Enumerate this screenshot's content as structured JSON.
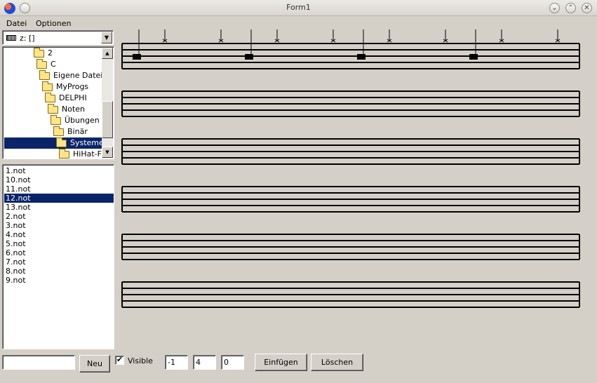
{
  "window": {
    "title": "Form1",
    "minimize": "⌄",
    "maximize": "⌃",
    "close": "✕"
  },
  "menu": [
    "Datei",
    "Optionen"
  ],
  "drive": {
    "value": "z: []",
    "icon": "drive-icon"
  },
  "tree": {
    "items": [
      {
        "label": "2",
        "indent": 0
      },
      {
        "label": "C",
        "indent": 1
      },
      {
        "label": "Eigene Dateien",
        "indent": 2
      },
      {
        "label": "MyProgs",
        "indent": 3
      },
      {
        "label": "DELPHI",
        "indent": 4
      },
      {
        "label": "Noten",
        "indent": 5
      },
      {
        "label": "Übungen",
        "indent": 6
      },
      {
        "label": "Binär",
        "indent": 7
      },
      {
        "label": "Systeme",
        "indent": 8,
        "selected": true
      },
      {
        "label": "HiHat-Fu",
        "indent": 9
      }
    ]
  },
  "files": {
    "items": [
      "1.not",
      "10.not",
      "11.not",
      "12.not",
      "13.not",
      "2.not",
      "3.not",
      "4.not",
      "5.not",
      "6.not",
      "7.not",
      "8.not",
      "9.not"
    ],
    "selected": "12.not"
  },
  "bottom": {
    "name_value": "",
    "new_label": "Neu",
    "visible_label": "Visible",
    "visible_checked": true,
    "fields": [
      "-1",
      "4",
      "0"
    ],
    "insert_label": "Einfügen",
    "delete_label": "Löschen"
  },
  "staves": {
    "count": 6,
    "notes_on_first": 4
  },
  "colors": {
    "selection": "#0a246a",
    "face": "#d4d0c8"
  }
}
